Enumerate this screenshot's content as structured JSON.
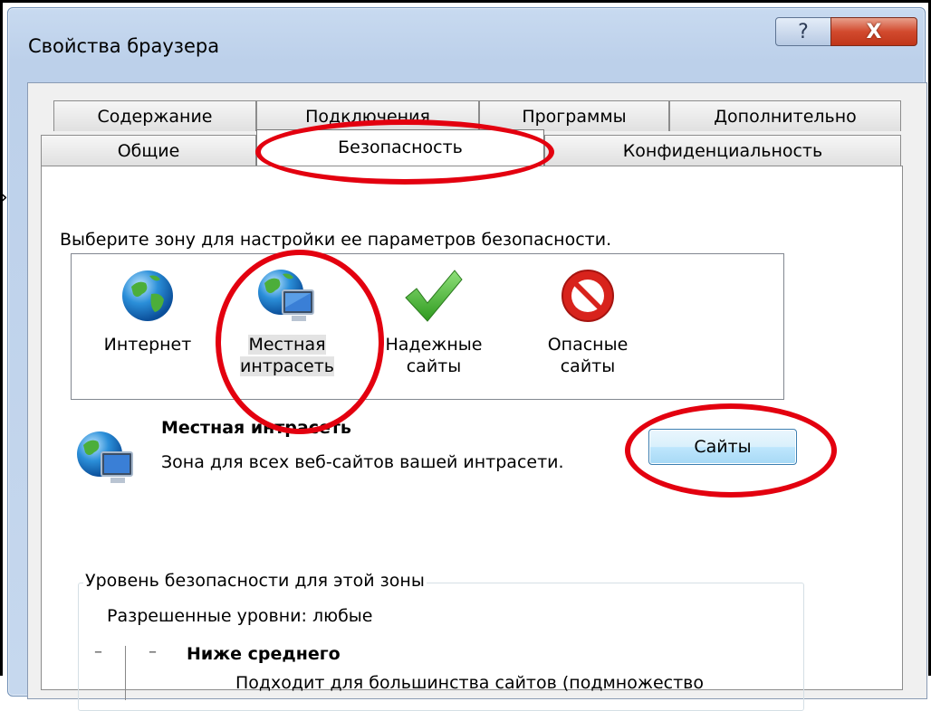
{
  "window": {
    "title": "Свойства браузера",
    "help_glyph": "?",
    "close_glyph": "X"
  },
  "tabs_row1": [
    "Содержание",
    "Подключения",
    "Программы",
    "Дополнительно"
  ],
  "tabs_row2": [
    "Общие",
    "Безопасность",
    "Конфиденциальность"
  ],
  "active_tab": "Безопасность",
  "security": {
    "prompt": "Выберите зону для настройки ее параметров безопасности.",
    "zones": [
      {
        "line1": "Интернет",
        "line2": "",
        "icon": "globe-icon"
      },
      {
        "line1": "Местная",
        "line2": "интрасеть",
        "icon": "intranet-icon"
      },
      {
        "line1": "Надежные",
        "line2": "сайты",
        "icon": "checkmark-icon"
      },
      {
        "line1": "Опасные",
        "line2": "сайты",
        "icon": "no-entry-icon"
      }
    ],
    "selected_zone": "Местная интрасеть",
    "zone_title": "Местная интрасеть",
    "zone_desc": "Зона для всех веб-сайтов вашей интрасети.",
    "sites_button": "Сайты",
    "level_group_label": "Уровень безопасности для этой зоны",
    "allowed_levels": "Разрешенные уровни: любые",
    "current_level": "Ниже среднего",
    "level_desc_partial": "Подходит для большинства сайтов (подмножество"
  },
  "colors": {
    "highlight_ellipse": "#e3000f",
    "close_button": "#c8391c",
    "window_frame": "#c2d5ec"
  }
}
